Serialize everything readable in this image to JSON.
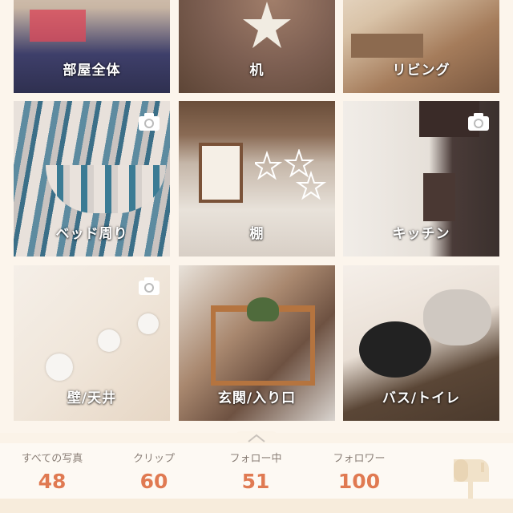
{
  "tiles": [
    {
      "label": "部屋全体",
      "has_camera": false
    },
    {
      "label": "机",
      "has_camera": false
    },
    {
      "label": "リビング",
      "has_camera": false
    },
    {
      "label": "ベッド周り",
      "has_camera": true
    },
    {
      "label": "棚",
      "has_camera": false
    },
    {
      "label": "キッチン",
      "has_camera": true
    },
    {
      "label": "壁/天井",
      "has_camera": true
    },
    {
      "label": "玄関/入り口",
      "has_camera": false
    },
    {
      "label": "バス/トイレ",
      "has_camera": false
    }
  ],
  "stats": [
    {
      "label": "すべての写真",
      "value": "48"
    },
    {
      "label": "クリップ",
      "value": "60"
    },
    {
      "label": "フォロー中",
      "value": "51"
    },
    {
      "label": "フォロワー",
      "value": "100"
    }
  ],
  "icons": {
    "camera": "camera-icon",
    "mailbox": "mailbox-icon",
    "handle": "chevron-up-icon"
  },
  "colors": {
    "accent": "#e07a52",
    "stat_label": "#8a7f77",
    "background": "#fbf3e8"
  }
}
